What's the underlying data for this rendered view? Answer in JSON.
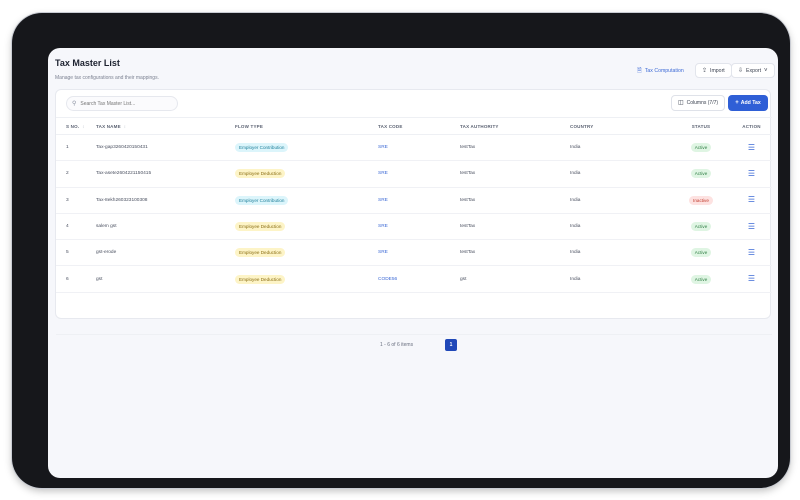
{
  "header": {
    "title": "Tax Master List",
    "subtitle": "Manage tax configurations and their mappings.",
    "tax_computation_label": "Tax Computation",
    "import_label": "Import",
    "export_label": "Export"
  },
  "toolbar": {
    "search_placeholder": "Search Tax Master List...",
    "columns_label": "Columns (7/7)",
    "add_label": "Add Tax"
  },
  "table": {
    "headers": {
      "sno": "S NO.",
      "tax_name": "TAX NAME",
      "flow_type": "FLOW TYPE",
      "tax_code": "TAX CODE",
      "tax_authority": "TAX AUTHORITY",
      "country": "COUNTRY",
      "status": "STATUS",
      "action": "ACTION"
    },
    "rows": [
      {
        "sno": "1",
        "name": "Tax-gap3260420150431",
        "flow": "Employer Contribution",
        "flow_kind": "contribution",
        "code": "SRE",
        "authority": "testTax",
        "country": "India",
        "status": "Active",
        "status_kind": "active"
      },
      {
        "sno": "2",
        "name": "Tax-asete2604221150415",
        "flow": "Employee Deduction",
        "flow_kind": "deduction",
        "code": "SRE",
        "authority": "testTax",
        "country": "India",
        "status": "Active",
        "status_kind": "active"
      },
      {
        "sno": "3",
        "name": "Tax-8ekh260323100308",
        "flow": "Employer Contribution",
        "flow_kind": "contribution",
        "code": "SRE",
        "authority": "testTax",
        "country": "India",
        "status": "Inactive",
        "status_kind": "inactive"
      },
      {
        "sno": "4",
        "name": "salem gst",
        "flow": "Employee Deduction",
        "flow_kind": "deduction",
        "code": "SRE",
        "authority": "testTax",
        "country": "India",
        "status": "Active",
        "status_kind": "active"
      },
      {
        "sno": "5",
        "name": "gst-erode",
        "flow": "Employee Deduction",
        "flow_kind": "deduction",
        "code": "SRE",
        "authority": "testTax",
        "country": "India",
        "status": "Active",
        "status_kind": "active"
      },
      {
        "sno": "6",
        "name": "gst",
        "flow": "Employee Deduction",
        "flow_kind": "deduction",
        "code": "CODE56",
        "authority": "gst",
        "country": "India",
        "status": "Active",
        "status_kind": "active"
      }
    ]
  },
  "pagination": {
    "items_info": "1 - 6 of 6 items",
    "current_page": "1"
  },
  "icons": {
    "tax_computation": "document-icon",
    "import": "upload-icon",
    "export": "download-icon",
    "search": "search-icon",
    "columns": "columns-icon",
    "add": "plus-icon",
    "action": "menu-icon"
  },
  "colors": {
    "accent": "#2f5fd6",
    "active_bg": "#dff5e3",
    "inactive_bg": "#fde2e1",
    "contribution_bg": "#dcf5fb",
    "deduction_bg": "#fdf4c7"
  }
}
